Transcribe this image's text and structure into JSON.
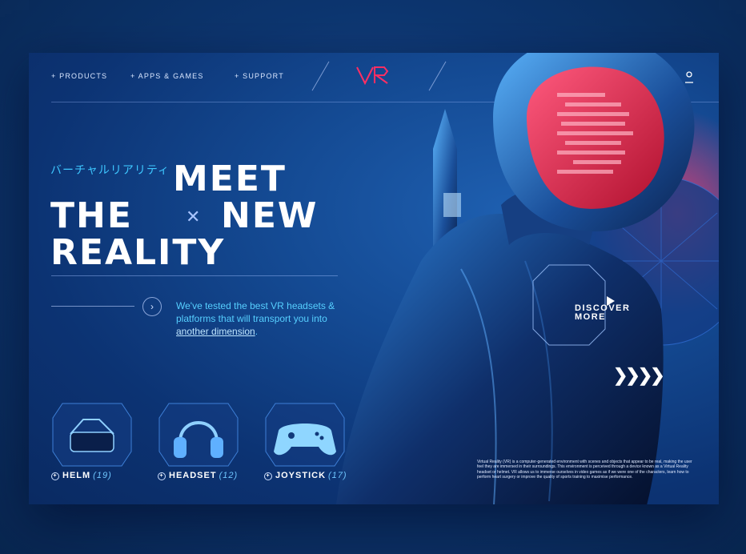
{
  "nav": {
    "items": [
      "+ PRODUCTS",
      "+ APPS & GAMES",
      "+ SUPPORT"
    ],
    "logo": "VR"
  },
  "hero": {
    "japanese": "バーチャルリアリティ",
    "line1": "MEET",
    "line2a": "THE",
    "line2b": "NEW",
    "line3": "REALITY",
    "desc_main": "We've tested the best VR headsets & platforms that will transport you into ",
    "desc_link": "another dimension",
    "desc_end": "."
  },
  "discover": {
    "line1": "DISCOVER",
    "line2": "MORE"
  },
  "products": [
    {
      "name": "HELM",
      "count": "(19)",
      "icon": "vr-helm-icon"
    },
    {
      "name": "HEADSET",
      "count": "(12)",
      "icon": "headphones-icon"
    },
    {
      "name": "JOYSTICK",
      "count": "(17)",
      "icon": "gamepad-icon"
    }
  ],
  "fine_print": "Virtual Reality (VR) is a computer-generated environment with scenes and objects that appear to be real, making the user feel they are immersed in their surroundings. This environment is perceived through a device known as a Virtual Reality headset or helmet. VR allows us to immerse ourselves in video games as if we were one of the characters, learn how to perform heart surgery or improve the quality of sports training to maximise performance.",
  "colors": {
    "accent": "#ff2e63",
    "cyan": "#3ec7ff",
    "bg": "#0c3373"
  }
}
